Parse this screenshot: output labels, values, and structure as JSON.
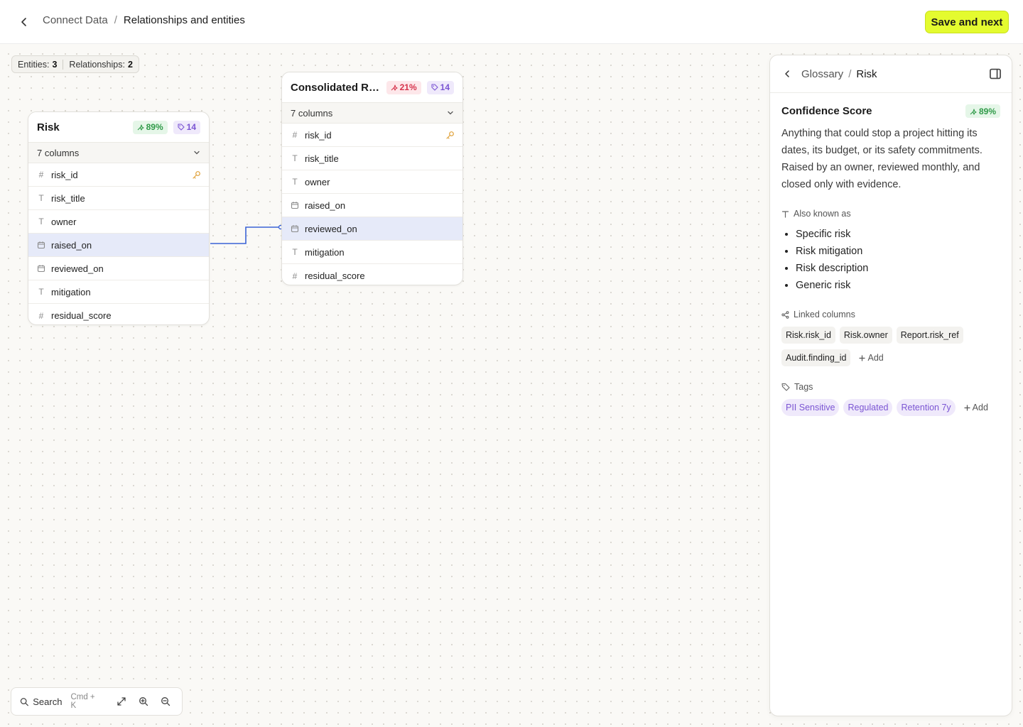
{
  "header": {
    "breadcrumb_parent": "Connect Data",
    "breadcrumb_separator": "/",
    "breadcrumb_current": "Relationships and entities",
    "save_label": "Save and next"
  },
  "stats": {
    "entities_label": "Entities:",
    "entities_count": "3",
    "relationships_label": "Relationships:",
    "relationships_count": "2"
  },
  "entities": [
    {
      "title": "Risk",
      "confidence": "89%",
      "tag_count": "14",
      "column_summary": "7 columns",
      "columns": [
        {
          "name": "risk_id",
          "type": "number",
          "key": true
        },
        {
          "name": "risk_title",
          "type": "text"
        },
        {
          "name": "owner",
          "type": "text"
        },
        {
          "name": "raised_on",
          "type": "date",
          "highlighted": true
        },
        {
          "name": "reviewed_on",
          "type": "date"
        },
        {
          "name": "mitigation",
          "type": "text"
        },
        {
          "name": "residual_score",
          "type": "number"
        }
      ]
    },
    {
      "title": "Consolidated Rep...",
      "confidence": "21%",
      "tag_count": "14",
      "column_summary": "7 columns",
      "columns": [
        {
          "name": "risk_id",
          "type": "number",
          "key": true
        },
        {
          "name": "risk_title",
          "type": "text"
        },
        {
          "name": "owner",
          "type": "text"
        },
        {
          "name": "raised_on",
          "type": "date"
        },
        {
          "name": "reviewed_on",
          "type": "date",
          "highlighted": true
        },
        {
          "name": "mitigation",
          "type": "text"
        },
        {
          "name": "residual_score",
          "type": "number"
        }
      ]
    }
  ],
  "toolbar": {
    "search_label": "Search",
    "shortcut": "Cmd + K"
  },
  "panel": {
    "breadcrumb_parent": "Glossary",
    "breadcrumb_separator": "/",
    "breadcrumb_current": "Risk",
    "field_title": "Confidence Score",
    "field_confidence": "89%",
    "description": "Anything that could stop a project hitting its dates, its budget, or its safety commitments. Raised by an owner, reviewed monthly, and closed only with evidence.",
    "aka_label": "Also known as",
    "aka": [
      "Specific risk",
      "Risk mitigation",
      "Risk description",
      "Generic risk"
    ],
    "linked_label": "Linked columns",
    "linked": [
      "Risk.risk_id",
      "Risk.owner",
      "Report.risk_ref",
      "Audit.finding_id"
    ],
    "add_label": "Add",
    "tags_label": "Tags",
    "tags": [
      "PII Sensitive",
      "Regulated",
      "Retention 7y"
    ]
  },
  "colors": {
    "accent": "#e4fb2f",
    "link_line": "#3b63d6",
    "highlight_row": "#e6eaf9"
  }
}
